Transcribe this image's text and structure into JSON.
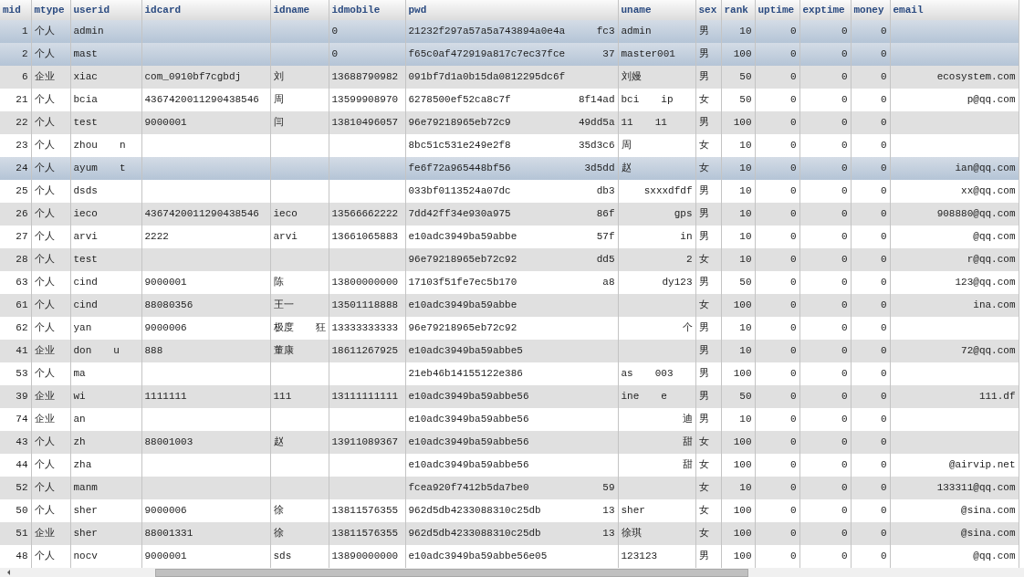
{
  "table": {
    "columns": [
      "mid",
      "mtype",
      "userid",
      "idcard",
      "idname",
      "idmobile",
      "pwd",
      "uname",
      "sex",
      "rank",
      "uptime",
      "exptime",
      "money",
      "email"
    ],
    "rows": [
      {
        "selected": true,
        "cells": [
          "1",
          "个人",
          "admin",
          "",
          "",
          "0",
          {
            "text": "21232f297a57a5a743894a0e4a",
            "tail": "fc3"
          },
          "admin",
          "男",
          "10",
          "0",
          "0",
          "0",
          ""
        ]
      },
      {
        "selected": true,
        "cells": [
          "2",
          "个人",
          "mast",
          "",
          "",
          "0",
          {
            "text": "f65c0af472919a817c7ec37fce",
            "tail": "37"
          },
          "master001",
          "男",
          "100",
          "0",
          "0",
          "0",
          ""
        ]
      },
      {
        "selected": false,
        "cells": [
          "6",
          "企业",
          "xiac",
          "com_0910bf7cgbdj",
          "刘",
          "13688790982",
          {
            "text": "091bf7d1a0b15da0812295dc6f"
          },
          "刘嫚",
          "男",
          "50",
          "0",
          "0",
          "0",
          {
            "text": "",
            "tail": "ecosystem.com"
          }
        ]
      },
      {
        "selected": false,
        "cells": [
          "21",
          "个人",
          "bcia",
          "4367420011290438546",
          "周",
          "13599908970",
          {
            "text": "6278500ef52ca8c7f",
            "tail": "8f14ad"
          },
          {
            "text": "bci",
            "tail": "ip"
          },
          "女",
          "50",
          "0",
          "0",
          "0",
          {
            "text": "",
            "tail": "p@qq.com"
          }
        ]
      },
      {
        "selected": false,
        "cells": [
          "22",
          "个人",
          "test",
          "9000001",
          "闫",
          "13810496057",
          {
            "text": "96e79218965eb72c9",
            "tail": "49dd5a"
          },
          {
            "text": "11",
            "tail": "11"
          },
          "男",
          "100",
          "0",
          "0",
          "0",
          ""
        ]
      },
      {
        "selected": false,
        "cells": [
          "23",
          "个人",
          {
            "text": "zhou",
            "tail": "n"
          },
          "",
          "",
          "",
          {
            "text": "8bc51c531e249e2f8",
            "tail": "35d3c6"
          },
          "周",
          "女",
          "10",
          "0",
          "0",
          "0",
          ""
        ]
      },
      {
        "selected": true,
        "cells": [
          "24",
          "个人",
          {
            "text": "ayum",
            "tail": "t"
          },
          "",
          "",
          "",
          {
            "text": "fe6f72a965448bf56",
            "tail": "3d5dd"
          },
          "赵",
          "女",
          "10",
          "0",
          "0",
          "0",
          {
            "text": "",
            "tail": "ian@qq.com"
          }
        ]
      },
      {
        "selected": false,
        "cells": [
          "25",
          "个人",
          "dsds",
          "",
          "",
          "",
          {
            "text": "033bf0113524a07dc",
            "tail": "db3"
          },
          {
            "text": "",
            "tail": "sxxxdfdf"
          },
          "男",
          "10",
          "0",
          "0",
          "0",
          {
            "text": "",
            "tail": "xx@qq.com"
          }
        ]
      },
      {
        "selected": false,
        "cells": [
          "26",
          "个人",
          "ieco",
          "4367420011290438546",
          "ieco",
          "13566662222",
          {
            "text": "7dd42ff34e930a975",
            "tail": "86f"
          },
          {
            "text": "",
            "tail": "gps"
          },
          "男",
          "10",
          "0",
          "0",
          "0",
          {
            "text": "",
            "tail": "908880@qq.com"
          }
        ]
      },
      {
        "selected": false,
        "cells": [
          "27",
          "个人",
          "arvi",
          "2222",
          "arvi",
          "13661065883",
          {
            "text": "e10adc3949ba59abbe",
            "tail": "57f"
          },
          {
            "text": "",
            "tail": "in"
          },
          "男",
          "10",
          "0",
          "0",
          "0",
          {
            "text": "",
            "tail": "@qq.com"
          }
        ]
      },
      {
        "selected": false,
        "cells": [
          "28",
          "个人",
          "test",
          "",
          "",
          "",
          {
            "text": "96e79218965eb72c92",
            "tail": "dd5"
          },
          {
            "text": "",
            "tail": "2"
          },
          "女",
          "10",
          "0",
          "0",
          "0",
          {
            "text": "",
            "tail": "r@qq.com"
          }
        ]
      },
      {
        "selected": false,
        "cells": [
          "63",
          "个人",
          "cind",
          "9000001",
          "陈",
          "13800000000",
          {
            "text": "17103f51fe7ec5b170",
            "tail": "a8"
          },
          {
            "text": "",
            "tail": "dy123"
          },
          "男",
          "50",
          "0",
          "0",
          "0",
          {
            "text": "",
            "tail": "123@qq.com"
          }
        ]
      },
      {
        "selected": false,
        "cells": [
          "61",
          "个人",
          "cind",
          "88080356",
          "王一",
          "13501118888",
          {
            "text": "e10adc3949ba59abbe"
          },
          "",
          "女",
          "100",
          "0",
          "0",
          "0",
          {
            "text": "",
            "tail": "ina.com"
          }
        ]
      },
      {
        "selected": false,
        "cells": [
          "62",
          "个人",
          "yan",
          "9000006",
          {
            "text": "极度",
            "tail": "狂"
          },
          "13333333333",
          {
            "text": "96e79218965eb72c92"
          },
          {
            "text": "",
            "tail": "个"
          },
          "男",
          "10",
          "0",
          "0",
          "0",
          ""
        ]
      },
      {
        "selected": false,
        "cells": [
          "41",
          "企业",
          {
            "text": "don",
            "tail": "u"
          },
          "888",
          "董康",
          "18611267925",
          {
            "text": "e10adc3949ba59abbe5"
          },
          "",
          "男",
          "10",
          "0",
          "0",
          "0",
          {
            "text": "",
            "tail": "72@qq.com"
          }
        ]
      },
      {
        "selected": false,
        "cells": [
          "53",
          "个人",
          "ma",
          "",
          "",
          "",
          {
            "text": "21eb46b14155122e386"
          },
          {
            "text": "as",
            "tail": "003"
          },
          "男",
          "100",
          "0",
          "0",
          "0",
          ""
        ]
      },
      {
        "selected": false,
        "cells": [
          "39",
          "企业",
          "wi",
          "1111111",
          "111",
          "13111111111",
          {
            "text": "e10adc3949ba59abbe56"
          },
          {
            "text": "ine",
            "tail": "e"
          },
          "男",
          "50",
          "0",
          "0",
          "0",
          {
            "text": "",
            "tail": "111.df"
          }
        ]
      },
      {
        "selected": false,
        "cells": [
          "74",
          "企业",
          "an",
          "",
          "",
          "",
          {
            "text": "e10adc3949ba59abbe56"
          },
          {
            "text": "",
            "tail": "迪"
          },
          "男",
          "10",
          "0",
          "0",
          "0",
          ""
        ]
      },
      {
        "selected": false,
        "cells": [
          "43",
          "个人",
          "zh",
          "88001003",
          "赵",
          "13911089367",
          {
            "text": "e10adc3949ba59abbe56"
          },
          {
            "text": "",
            "tail": "甜"
          },
          "女",
          "100",
          "0",
          "0",
          "0",
          ""
        ]
      },
      {
        "selected": false,
        "cells": [
          "44",
          "个人",
          "zha",
          "",
          "",
          "",
          {
            "text": "e10adc3949ba59abbe56"
          },
          {
            "text": "",
            "tail": "甜"
          },
          "女",
          "100",
          "0",
          "0",
          "0",
          {
            "text": "",
            "tail": "@airvip.net"
          }
        ]
      },
      {
        "selected": false,
        "cells": [
          "52",
          "个人",
          "manm",
          "",
          "",
          "",
          {
            "text": "fcea920f7412b5da7be0",
            "tail": "59"
          },
          "",
          "女",
          "10",
          "0",
          "0",
          "0",
          {
            "text": "",
            "tail": "133311@qq.com"
          }
        ]
      },
      {
        "selected": false,
        "cells": [
          "50",
          "个人",
          "sher",
          "9000006",
          "徐",
          "13811576355",
          {
            "text": "962d5db4233088310c25db",
            "tail": "13"
          },
          "sher",
          "女",
          "100",
          "0",
          "0",
          "0",
          {
            "text": "",
            "tail": "@sina.com"
          }
        ]
      },
      {
        "selected": false,
        "cells": [
          "51",
          "企业",
          "sher",
          "88001331",
          "徐",
          "13811576355",
          {
            "text": "962d5db4233088310c25db",
            "tail": "13"
          },
          "徐琪",
          "女",
          "100",
          "0",
          "0",
          "0",
          {
            "text": "",
            "tail": "@sina.com"
          }
        ]
      },
      {
        "selected": false,
        "cells": [
          "48",
          "个人",
          "nocv",
          "9000001",
          "sds",
          "13890000000",
          {
            "text": "e10adc3949ba59abbe56e05"
          },
          "123123",
          "男",
          "100",
          "0",
          "0",
          "0",
          {
            "text": "",
            "tail": "@qq.com"
          }
        ]
      }
    ]
  }
}
